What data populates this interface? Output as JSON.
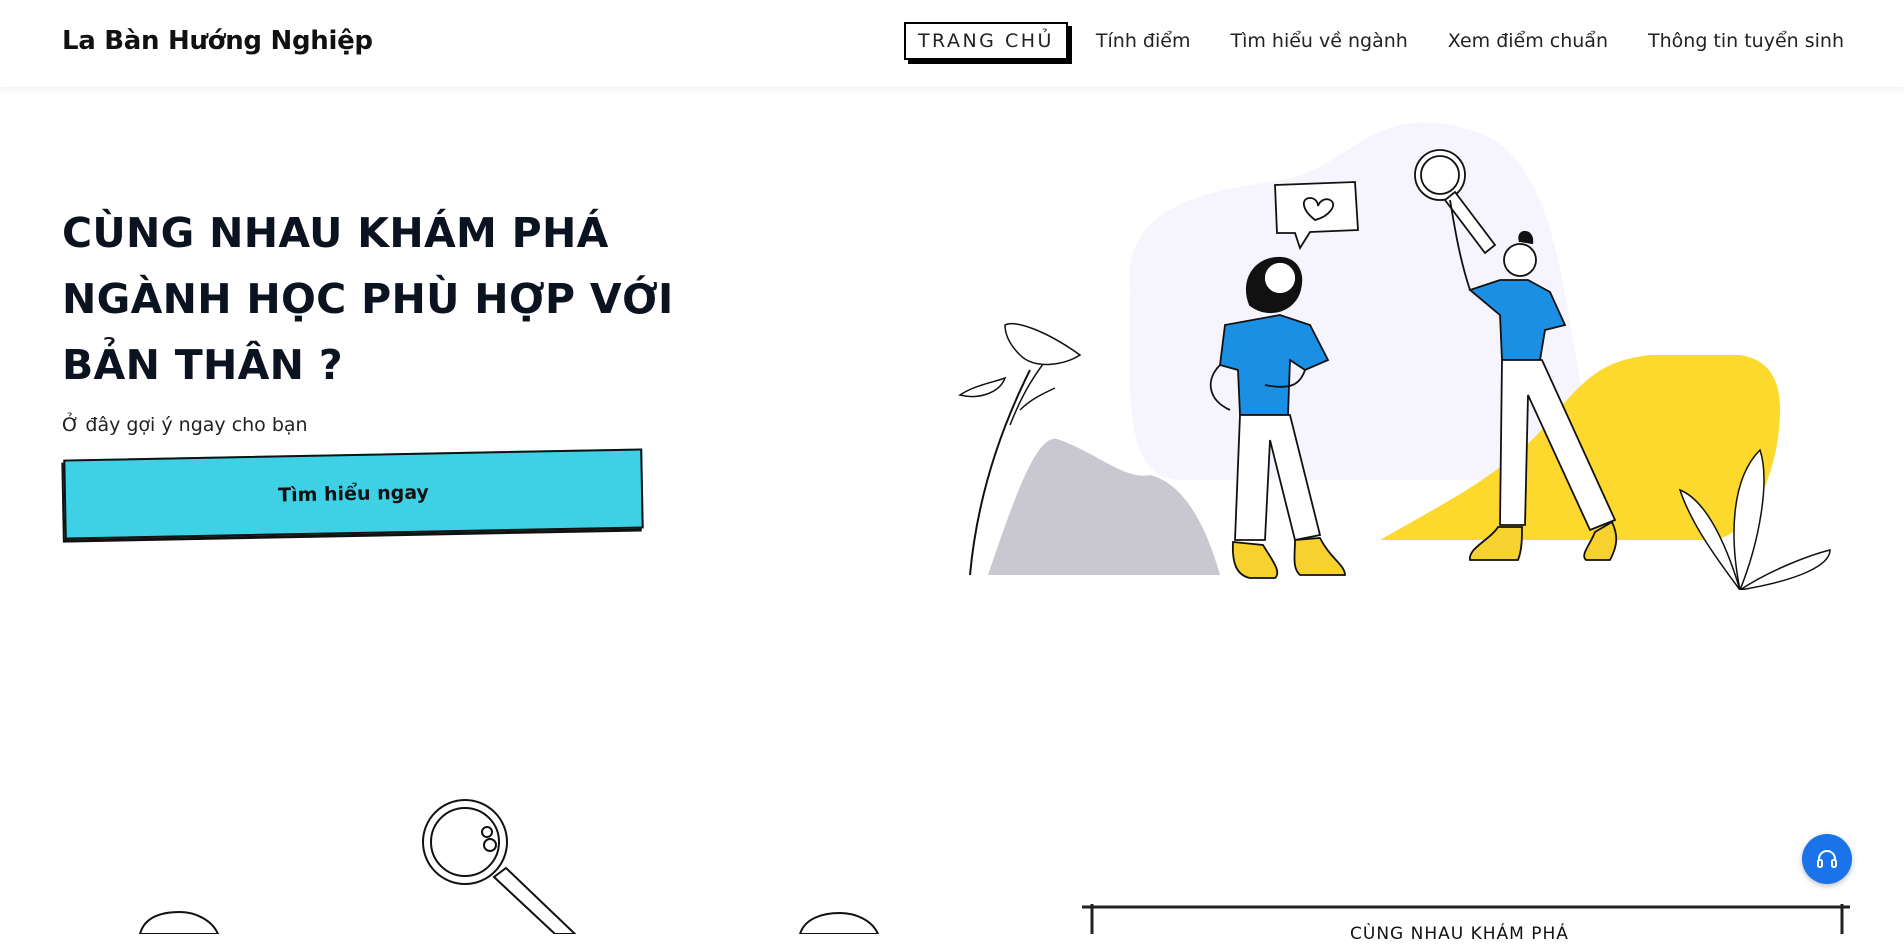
{
  "header": {
    "brand": "La Bàn Hướng Nghiệp",
    "nav": [
      {
        "label": "TRANG CHỦ",
        "active": true
      },
      {
        "label": "Tính điểm"
      },
      {
        "label": "Tìm hiểu về ngành"
      },
      {
        "label": "Xem điểm chuẩn"
      },
      {
        "label": "Thông tin tuyển sinh"
      }
    ]
  },
  "hero": {
    "title": "CÙNG NHAU KHÁM PHÁ NGÀNH HỌC PHÙ HỢP VỚI BẢN THÂN ?",
    "subtitle": "Ở đây gợi ý ngay cho bạn",
    "cta_label": "Tìm hiểu ngay"
  },
  "section_card": {
    "title": "CÙNG NHAU KHÁM PHÁ"
  },
  "icons": {
    "support": "headset-icon"
  },
  "colors": {
    "accent": "#3ed1e6",
    "shirt": "#1a8fe3",
    "boots": "#f7d22f",
    "support": "#1a73e8"
  }
}
